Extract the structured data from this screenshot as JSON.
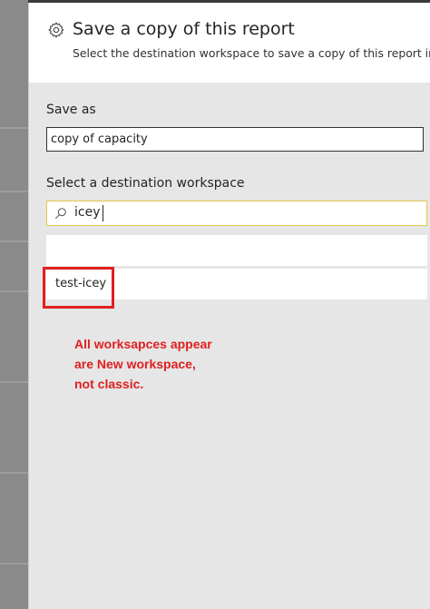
{
  "dialog": {
    "title": "Save a copy of this report",
    "subtitle": "Select the destination workspace to save a copy of this report into."
  },
  "save_as": {
    "label": "Save as",
    "value": "copy of capacity"
  },
  "destination": {
    "label": "Select a destination workspace",
    "search_value": "icey",
    "results": [
      "test-icey"
    ]
  },
  "annotation": {
    "lines": [
      "All worksapces appear",
      "are New workspace,",
      "not classic."
    ],
    "color": "#e02020"
  },
  "colors": {
    "focus_border": "#e8c64a",
    "panel_bg": "#e6e6e6"
  }
}
